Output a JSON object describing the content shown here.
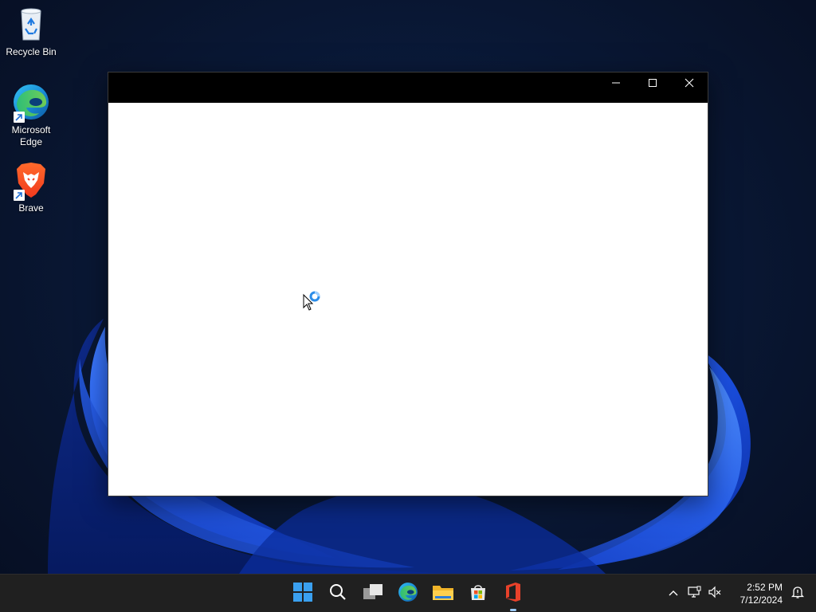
{
  "desktop": {
    "icons": [
      {
        "label": "Recycle Bin",
        "icon": "recycle-bin-icon"
      },
      {
        "label": "Microsoft Edge",
        "icon": "edge-icon"
      },
      {
        "label": "Brave",
        "icon": "brave-icon"
      }
    ]
  },
  "window": {
    "title": "",
    "controls": {
      "minimize": "minimize-icon",
      "maximize": "maximize-icon",
      "close": "close-icon"
    }
  },
  "cursor": {
    "state": "busy",
    "icon": "working-in-background-cursor-icon"
  },
  "taskbar": {
    "apps": [
      {
        "name": "Start",
        "icon": "windows-start-icon"
      },
      {
        "name": "Search",
        "icon": "search-icon"
      },
      {
        "name": "Task View",
        "icon": "task-view-icon"
      },
      {
        "name": "Microsoft Edge",
        "icon": "edge-icon"
      },
      {
        "name": "File Explorer",
        "icon": "file-explorer-icon"
      },
      {
        "name": "Microsoft Store",
        "icon": "store-icon"
      },
      {
        "name": "Microsoft Office",
        "icon": "office-icon",
        "running": true
      }
    ],
    "tray": {
      "overflow_icon": "chevron-up-icon",
      "network_icon": "network-icon",
      "volume_icon": "volume-muted-icon",
      "notification_icon": "notification-icon",
      "time": "2:52 PM",
      "date": "7/12/2024"
    }
  },
  "colors": {
    "titlebar": "#000000",
    "taskbar": "#202020",
    "accent": "#0078d4"
  }
}
